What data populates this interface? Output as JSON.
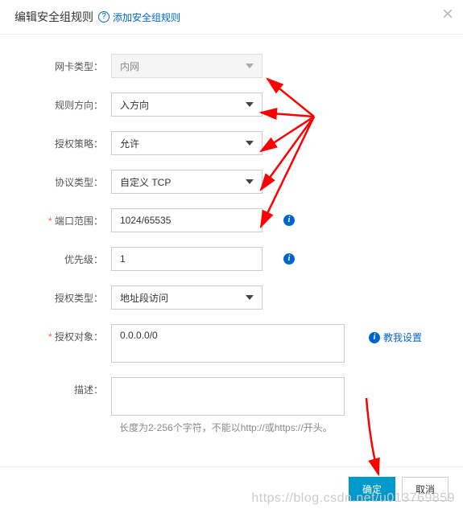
{
  "dialog": {
    "title": "编辑安全组规则",
    "help_link_text": "添加安全组规则"
  },
  "fields": {
    "nic_type": {
      "label": "网卡类型：",
      "value": "内网"
    },
    "direction": {
      "label": "规则方向：",
      "value": "入方向"
    },
    "policy": {
      "label": "授权策略：",
      "value": "允许"
    },
    "protocol": {
      "label": "协议类型：",
      "value": "自定义 TCP"
    },
    "port_range": {
      "label": "端口范围：",
      "value": "1024/65535"
    },
    "priority": {
      "label": "优先级：",
      "value": "1"
    },
    "auth_type": {
      "label": "授权类型：",
      "value": "地址段访问"
    },
    "auth_object": {
      "label": "授权对象：",
      "value": "0.0.0.0/0",
      "teach_text": "教我设置"
    },
    "description": {
      "label": "描述：",
      "value": "",
      "hint": "长度为2-256个字符，不能以http://或https://开头。"
    }
  },
  "footer": {
    "confirm": "确定",
    "cancel": "取消"
  },
  "watermark": "https://blog.csdn.net/u013769859"
}
